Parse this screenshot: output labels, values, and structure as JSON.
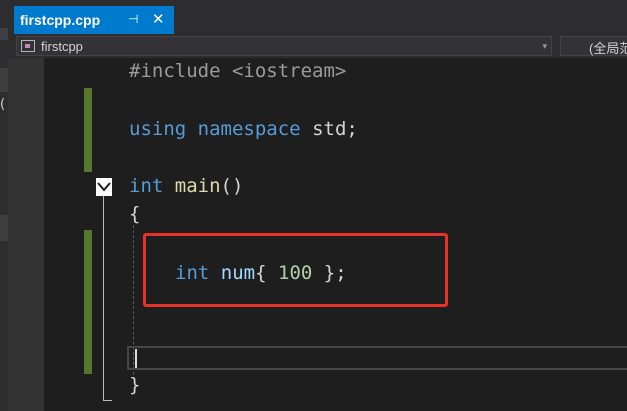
{
  "tab": {
    "title": "firstcpp.cpp",
    "pin_glyph": "⊣",
    "close_glyph": "✕",
    "accent": "#007acc"
  },
  "nav": {
    "context": "firstcpp",
    "scope": "(全局范",
    "dropdown_glyph": "▾"
  },
  "left_panel": {
    "glyph": "("
  },
  "code": {
    "line1": {
      "directive": "#include",
      "header": "<iostream>"
    },
    "line3": {
      "kw1": "using",
      "kw2": "namespace",
      "rest": "std;"
    },
    "line5": {
      "type": "int",
      "name": "main",
      "parens": "()"
    },
    "line6": "{",
    "line8": {
      "type": "int",
      "name": "num",
      "open": "{",
      "value": "100",
      "close": "};"
    },
    "line11": "}"
  },
  "colors": {
    "keyword": "#569cd6",
    "change_bar": "#57782c",
    "highlight_box": "#e8312a"
  }
}
